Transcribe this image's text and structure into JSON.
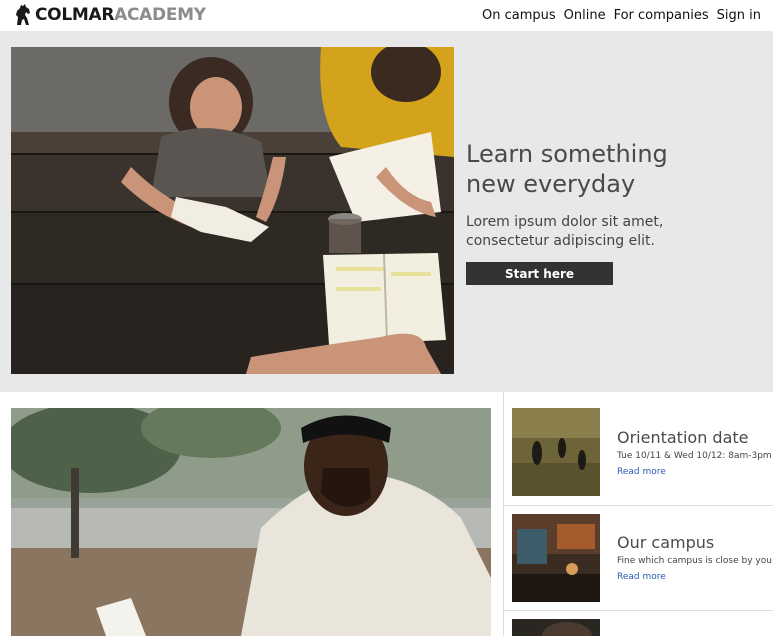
{
  "header": {
    "logo_bold": "COLMAR",
    "logo_light": "ACADEMY",
    "nav": [
      "On campus",
      "Online",
      "For companies",
      "Sign in"
    ]
  },
  "hero": {
    "title": "Learn something new everyday",
    "text": "Lorem ipsum dolor sit amet, consectetur adipiscing elit.",
    "button": "Start here"
  },
  "cards": [
    {
      "title": "Orientation date",
      "subtitle": "Tue 10/11 & Wed 10/12: 8am-3pm",
      "link": "Read more"
    },
    {
      "title": "Our campus",
      "subtitle": "Fine which campus is close by you",
      "link": "Read more"
    }
  ],
  "colors": {
    "hero_bg": "#e8e8e8",
    "button_bg": "#333333",
    "link": "#2a5db0",
    "logo_light": "#8c8c8c"
  }
}
